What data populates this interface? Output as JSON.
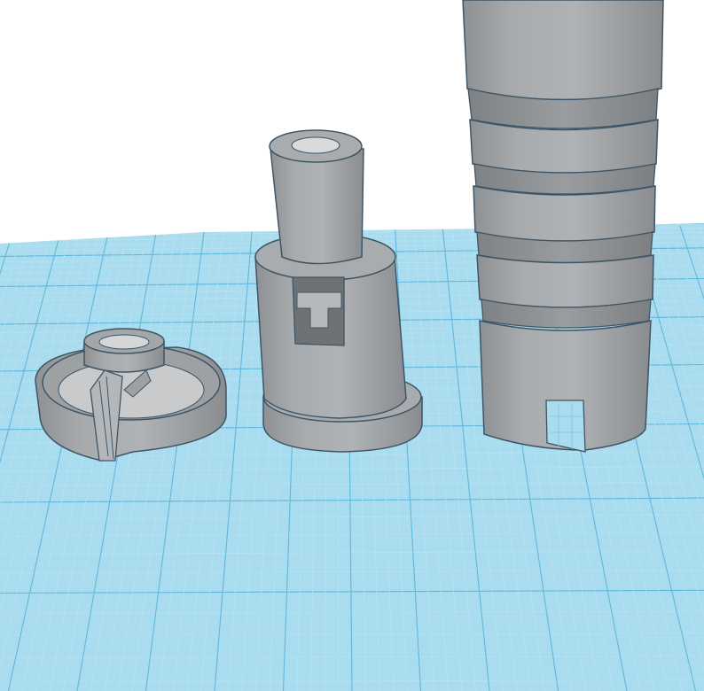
{
  "viewport": {
    "type": "3d-modeling-workplane-view",
    "background_color": "#ffffff"
  },
  "workplane": {
    "grid": true,
    "fill_color": "#a9dcef",
    "minor_line_color": "#b9e3f2",
    "major_line_color": "#5fb8dc"
  },
  "objects": [
    {
      "name": "clip-ring",
      "shape": "ring-with-center-collar-and-side-clip",
      "color": "#a4a7aa"
    },
    {
      "name": "stepped-cylinder",
      "shape": "cylinder-with-tube-and-flanged-base-and-window",
      "color": "#a4a7aa"
    },
    {
      "name": "ribbed-tube",
      "shape": "tall-tube-with-rings-and-slot",
      "color": "#a4a7aa"
    }
  ]
}
